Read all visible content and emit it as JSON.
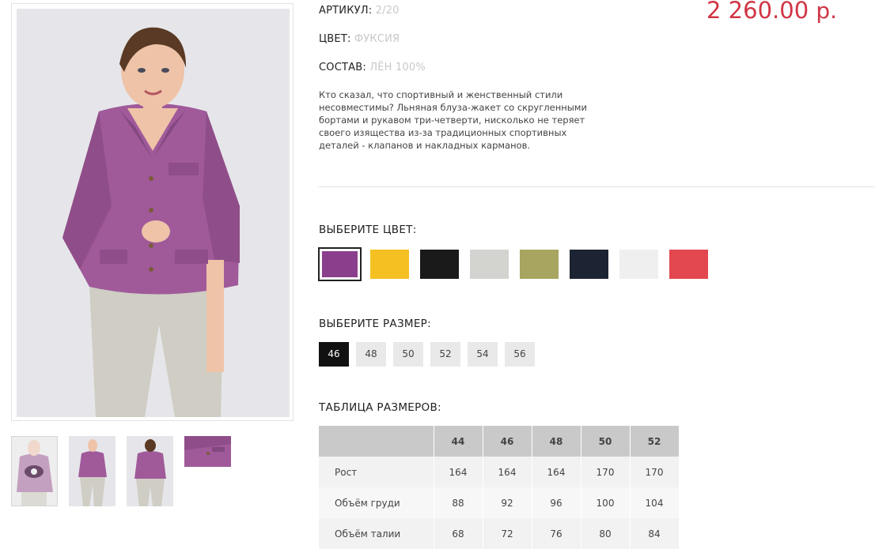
{
  "product": {
    "article_label": "АРТИКУЛ:",
    "article_value": "2/20",
    "color_label": "ЦВЕТ:",
    "color_value": "ФУКСИЯ",
    "composition_label": "СОСТАВ:",
    "composition_value": "ЛЁН 100%",
    "price_amount": "2 260.00",
    "price_currency": "р.",
    "description": "Кто сказал, что спортивный и женственный стили несовместимы? Льняная блуза-жакет со скругленными бортами и рукавом три-четверти, нисколько не теряет своего изящества из-за традиционных спортивных деталей - клапанов и накладных карманов."
  },
  "color_picker": {
    "title": "ВЫБЕРИТЕ ЦВЕТ:",
    "swatches": [
      {
        "name": "fuchsia",
        "hex": "#8a3f8c",
        "selected": true
      },
      {
        "name": "yellow",
        "hex": "#f4c022",
        "selected": false
      },
      {
        "name": "black",
        "hex": "#1a1a1a",
        "selected": false
      },
      {
        "name": "light-gray",
        "hex": "#d3d4d0",
        "selected": false
      },
      {
        "name": "olive",
        "hex": "#a7a560",
        "selected": false
      },
      {
        "name": "navy",
        "hex": "#1c2333",
        "selected": false
      },
      {
        "name": "white",
        "hex": "#efefef",
        "selected": false
      },
      {
        "name": "red",
        "hex": "#e3474f",
        "selected": false
      }
    ]
  },
  "size_picker": {
    "title": "ВЫБЕРИТЕ РАЗМЕР:",
    "sizes": [
      "46",
      "48",
      "50",
      "52",
      "54",
      "56"
    ],
    "active": "46"
  },
  "size_table": {
    "title": "ТАБЛИЦА РАЗМЕРОВ:",
    "headers": [
      "",
      "44",
      "46",
      "48",
      "50",
      "52"
    ],
    "rows": [
      [
        "Рост",
        "164",
        "164",
        "164",
        "170",
        "170"
      ],
      [
        "Объём груди",
        "88",
        "92",
        "96",
        "100",
        "104"
      ],
      [
        "Объём талии",
        "68",
        "72",
        "76",
        "80",
        "84"
      ]
    ]
  },
  "gallery": {
    "thumbnails": [
      "thumb-front-zoom",
      "thumb-full-front",
      "thumb-full-back",
      "thumb-detail"
    ]
  },
  "colors": {
    "price": "#d03545",
    "jacket": "#a05a9a",
    "accent_dark": "#111111"
  }
}
